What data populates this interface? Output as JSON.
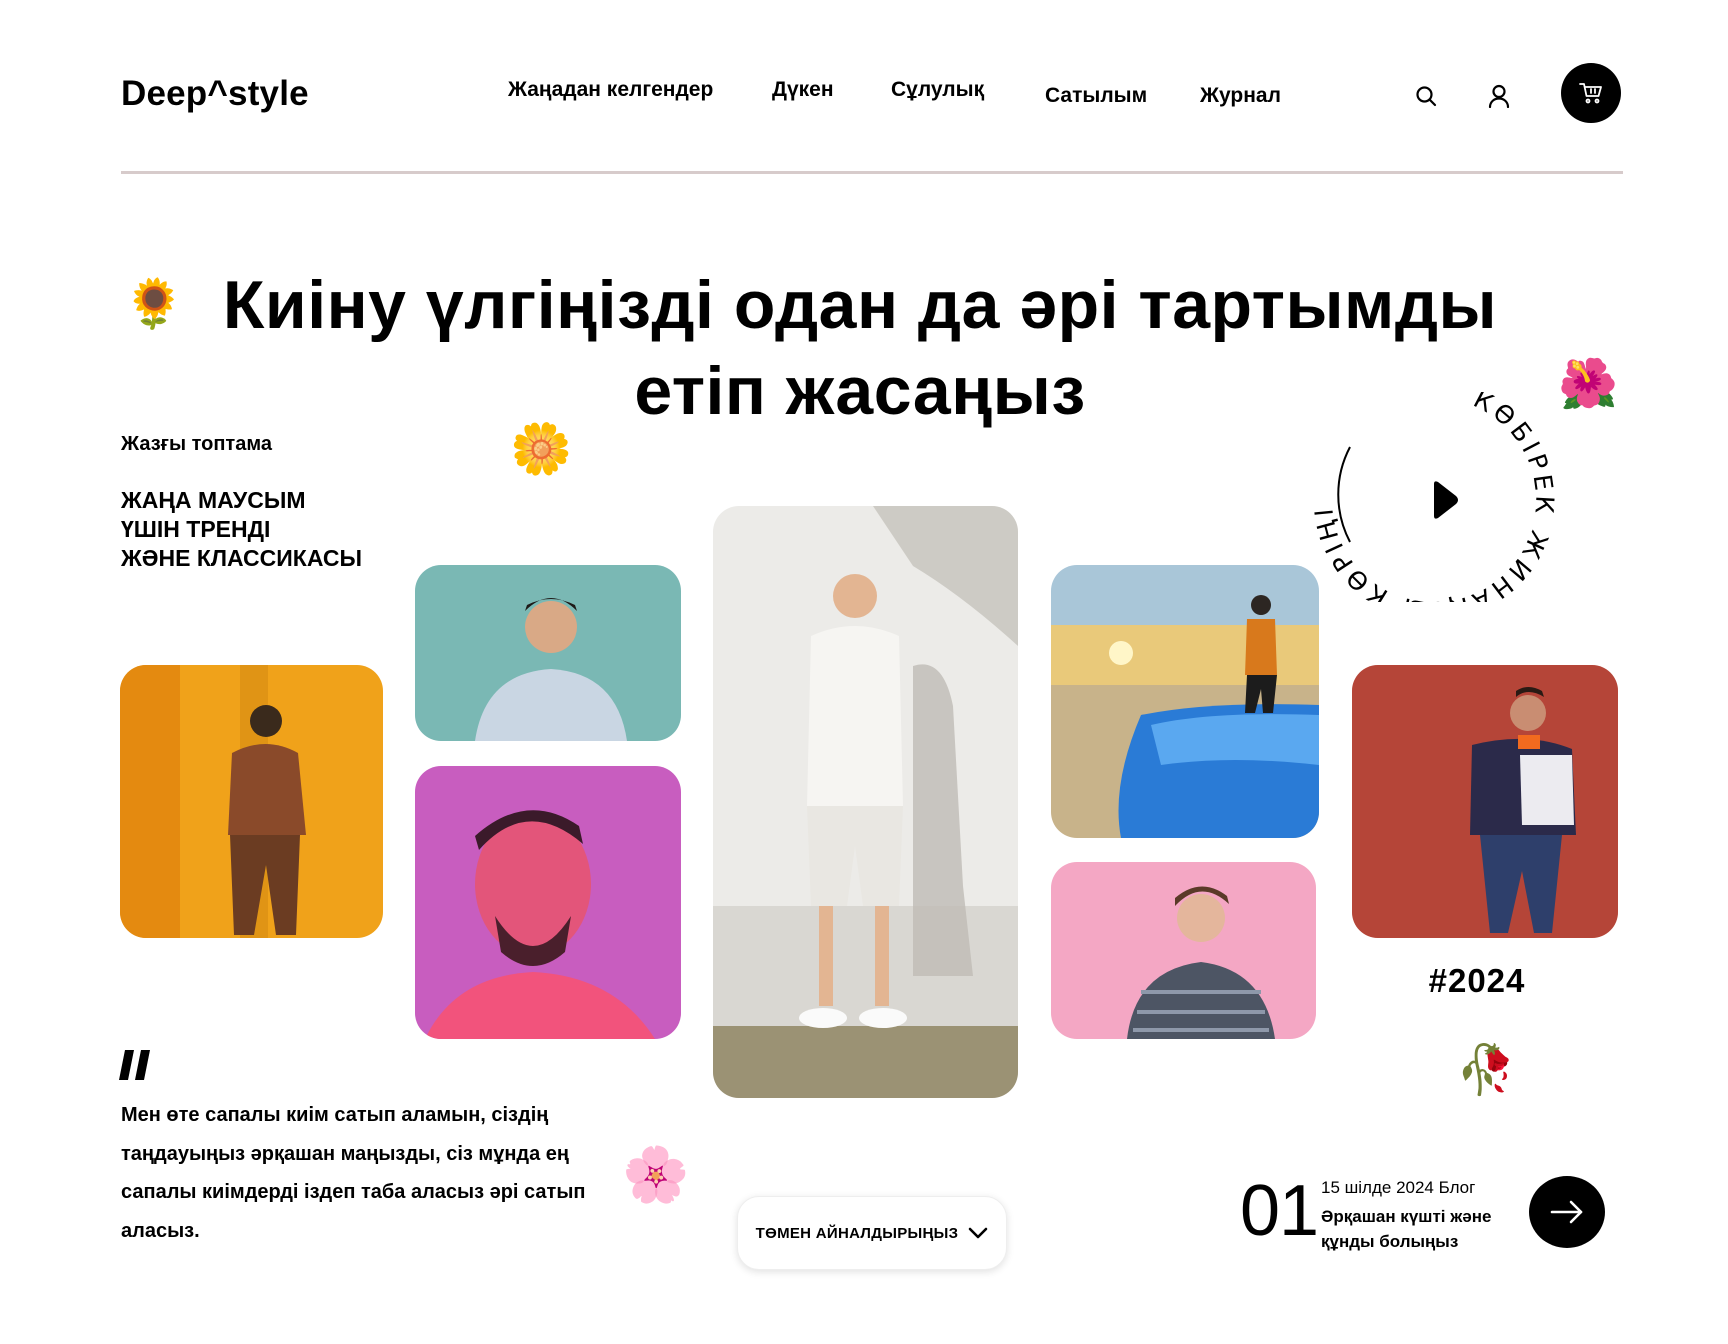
{
  "header": {
    "logo": "Deep^style",
    "nav": [
      "Жаңадан келгендер",
      "Дүкен",
      "Сұлулық",
      "Сатылым",
      "Журнал"
    ]
  },
  "hero": {
    "headline_line1": "Киіну үлгіңізді одан да әрі тартымды",
    "headline_line2": "етіп жасаңыз",
    "collection_label": "Жазғы топтама",
    "season_lines": [
      "ЖАҢА МАУСЫМ",
      "ҮШІН ТРЕНДІ",
      "ЖӘНЕ КЛАССИКАСЫ"
    ]
  },
  "badge": {
    "circular_text": "КӨБІРЕК ЖИНАҚТЫ КӨРІҢІЗ"
  },
  "hashtag": "#2024",
  "quote": {
    "text": "Мен өте сапалы киім сатып аламын, сіздің таңдауыңыз әрқашан маңызды, сіз мұнда ең сапалы киімдерді іздеп таба аласыз әрі сатып аласыз."
  },
  "scroll": {
    "label": "ТӨМЕН АЙНАЛДЫРЫҢЫЗ"
  },
  "blog": {
    "number": "01",
    "date": "15 шілде 2024 Блог",
    "title": "Әрқашан күшті және құнды болыңыз"
  },
  "icons": {
    "search": "search-icon",
    "user": "user-icon",
    "cart": "cart-icon",
    "play": "play-icon",
    "chevron": "chevron-down-icon",
    "arrow": "arrow-right-icon",
    "quote": "quote-icon"
  },
  "colors": {
    "accent": "#000000",
    "divider": "#d7cbcb"
  }
}
